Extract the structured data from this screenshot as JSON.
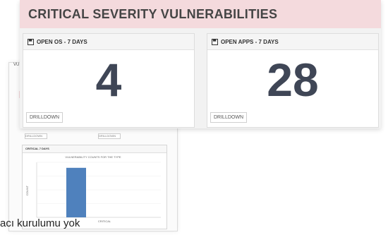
{
  "callout": {
    "title": "CRITICAL SEVERITY VULNERABILITIES",
    "cards": [
      {
        "label": "OPEN OS - 7 DAYS",
        "value": "4",
        "drilldown": "DRILLDOWN"
      },
      {
        "label": "OPEN APPS - 7 DAYS",
        "value": "28",
        "drilldown": "DRILLDOWN"
      }
    ]
  },
  "background": {
    "side_label": "VU",
    "header_letter": "C",
    "card_drill_a": "DRILLDOWN",
    "card_drill_b": "DRILLDOWN",
    "chart_title": "CRITICAL 7 DAYS",
    "chart_subtitle": "VULNERABILITY COUNTS FOR THE TYPE",
    "chart_ylabel": "COUNT",
    "chart_xcategory": "CRITICAL",
    "chart_bar_value": 900,
    "chart_ymax": 1000
  },
  "caption": {
    "text": "acı kurulumu yok"
  },
  "colors": {
    "header_bg": "#f4dadd",
    "value_text": "#3f4656",
    "bar": "#4f81bd"
  }
}
